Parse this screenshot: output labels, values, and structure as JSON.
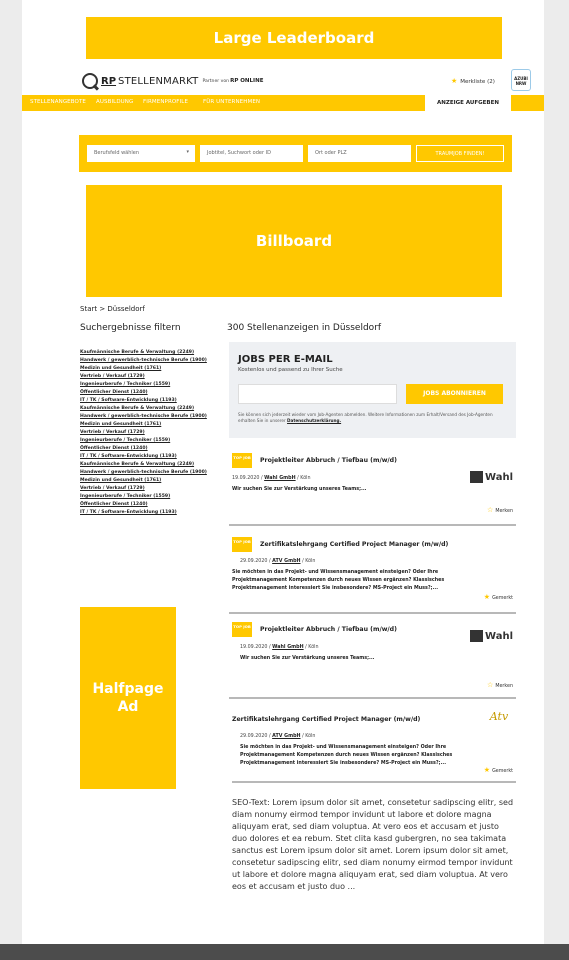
{
  "ads": {
    "leaderboard": "Large Leaderboard",
    "billboard": "Billboard",
    "halfpage": "Halfpage Ad"
  },
  "header": {
    "logo_rp": "RP",
    "logo_name": "STELLENMARKT",
    "logo_partner": "Partner von",
    "logo_rponline": "RP ONLINE",
    "merkliste": "Merkliste (2)",
    "azubi_badge": "AZUBI NRW"
  },
  "nav": {
    "items": [
      "STELLENANGEBOTE",
      "AUSBILDUNG",
      "FIRMENPROFILE",
      "FÜR UNTERNEHMEN"
    ],
    "cta": "ANZEIGE AUFGEBEN"
  },
  "search": {
    "field1": "Berufsfeld wählen",
    "field2": "Jobtitel, Suchwort oder ID",
    "field3": "Ort oder PLZ",
    "button": "TRAUMJOB FINDEN!"
  },
  "breadcrumb": "Start > Düsseldorf",
  "sidebar": {
    "heading": "Suchergebnisse filtern",
    "filters": [
      "Kaufmännische Berufe & Verwaltung (2249)",
      "Handwerk / gewerblich-technische Berufe (1900)",
      "Medizin und Gesundheit (1761)",
      "Vertrieb / Verkauf (1729)",
      "Ingenieurberufe / Techniker (1559)",
      "Öffentlicher Dienst (1240)",
      "IT / TK / Software-Entwicklung (1193)",
      "Kaufmännische Berufe & Verwaltung (2249)",
      "Handwerk / gewerblich-technische Berufe (1900)",
      "Medizin und Gesundheit (1761)",
      "Vertrieb / Verkauf (1729)",
      "Ingenieurberufe / Techniker (1559)",
      "Öffentlicher Dienst (1240)",
      "IT / TK / Software-Entwicklung (1193)",
      "Kaufmännische Berufe & Verwaltung (2249)",
      "Handwerk / gewerblich-technische Berufe (1900)",
      "Medizin und Gesundheit (1761)",
      "Vertrieb / Verkauf (1729)",
      "Ingenieurberufe / Techniker (1559)",
      "Öffentlicher Dienst (1240)",
      "IT / TK / Software-Entwicklung (1193)"
    ]
  },
  "results": {
    "heading": "300 Stellenanzeigen in Düsseldorf"
  },
  "jobmail": {
    "title": "JOBS PER E-MAIL",
    "subtitle": "Kostenlos und passend zu Ihrer Suche",
    "button": "JOBS ABONNIEREN",
    "note": "Sie können sich jederzeit wieder vom Job-Agenten abmelden. Weitere Informationen zum Erhalt/Versand des Job-Agenten erhalten Sie in unserer",
    "note_link": "Datenschutzerklärung."
  },
  "jobs": [
    {
      "badge": "TOP JOB",
      "title": "Projektleiter Abbruch / Tiefbau (m/w/d)",
      "date": "19.09.2020 /",
      "company": "Wahl GmbH",
      "city": "/ Köln",
      "desc": "Wir suchen Sie zur Verstärkung unseres Teams;...",
      "action": "Merken",
      "logo": "Wahl"
    },
    {
      "badge": "TOP JOB",
      "title": "Zertifikatslehrgang Certified Project Manager (m/w/d)",
      "date": "29.09.2020 /",
      "company": "ATV GmbH",
      "city": "/ Köln",
      "desc": "Sie möchten in das Projekt- und Wissensmanagement einsteigen? Oder Ihre Projektmanagement Kompetenzen durch neues Wissen ergänzen? Klassisches Projektmanagement interessiert Sie insbesondere? MS-Project ein Muss?;...",
      "action": "Gemerkt"
    },
    {
      "badge": "TOP JOB",
      "title": "Projektleiter Abbruch / Tiefbau (m/w/d)",
      "date": "19.09.2020 /",
      "company": "Wahl GmbH",
      "city": "/ Köln",
      "desc": "Wir suchen Sie zur Verstärkung unseres Teams;...",
      "action": "Merken",
      "logo": "Wahl"
    },
    {
      "title": "Zertifikatslehrgang Certified Project Manager (m/w/d)",
      "date": "29.09.2020 /",
      "company": "ATV GmbH",
      "city": "/ Köln",
      "desc": "Sie möchten in das Projekt- und Wissensmanagement einsteigen? Oder Ihre Projektmanagement Kompetenzen durch neues Wissen ergänzen? Klassisches Projektmanagement interessiert Sie insbesondere? MS-Project ein Muss?;...",
      "action": "Gemerkt",
      "logo": "Atv"
    }
  ],
  "seo": "SEO-Text: Lorem ipsum dolor sit amet, consetetur sadipscing elitr, sed diam nonumy eirmod tempor invidunt ut labore et dolore magna aliquyam erat, sed diam voluptua. At vero eos et accusam et justo duo dolores et ea rebum. Stet clita kasd gubergren, no sea takimata sanctus est Lorem ipsum dolor sit amet. Lorem ipsum dolor sit amet, consetetur sadipscing elitr, sed diam nonumy eirmod tempor invidunt ut labore et dolore magna aliquyam erat, sed diam voluptua. At vero eos et accusam et justo duo ...",
  "colors": {
    "accent": "#ffc800",
    "footer": "#4c4c4c",
    "jobmail_bg": "#eef0f3"
  }
}
